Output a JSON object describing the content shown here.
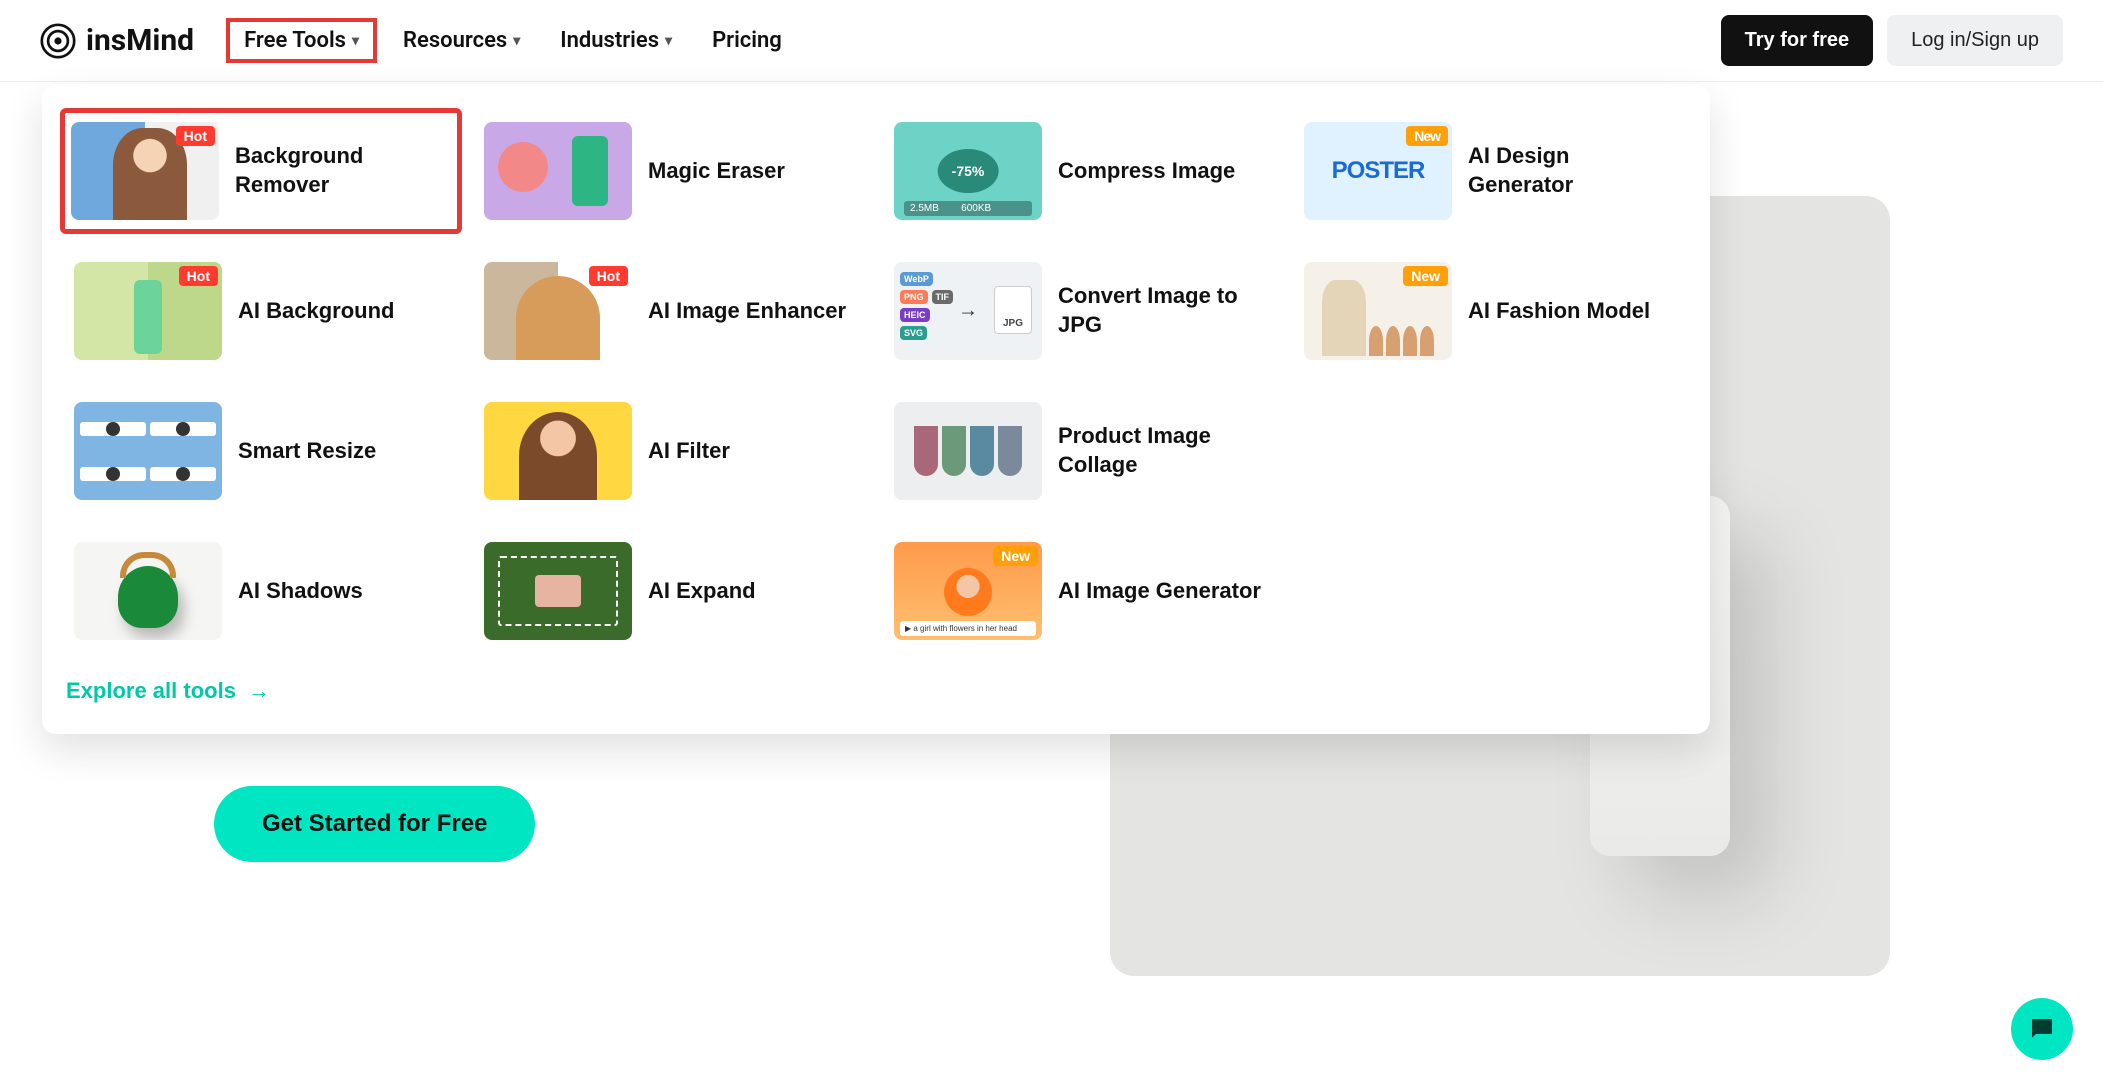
{
  "brand": "insMind",
  "nav": {
    "free_tools": "Free Tools",
    "resources": "Resources",
    "industries": "Industries",
    "pricing": "Pricing"
  },
  "auth": {
    "try": "Try for free",
    "login": "Log in/Sign up"
  },
  "dropdown": {
    "tools": [
      {
        "label": "Background Remover",
        "badge": "Hot",
        "thumb": "bgremove",
        "highlight": true
      },
      {
        "label": "Magic Eraser",
        "badge": null,
        "thumb": "magic"
      },
      {
        "label": "Compress Image",
        "badge": null,
        "thumb": "compress"
      },
      {
        "label": "AI Design Generator",
        "badge": "New",
        "thumb": "design"
      },
      {
        "label": "AI Background",
        "badge": "Hot",
        "thumb": "aibg"
      },
      {
        "label": "AI Image Enhancer",
        "badge": "Hot",
        "thumb": "enhance"
      },
      {
        "label": "Convert Image to JPG",
        "badge": null,
        "thumb": "convert"
      },
      {
        "label": "AI Fashion Model",
        "badge": "New",
        "thumb": "fashion"
      },
      {
        "label": "Smart Resize",
        "badge": null,
        "thumb": "resize"
      },
      {
        "label": "AI Filter",
        "badge": null,
        "thumb": "filter"
      },
      {
        "label": "Product Image Collage",
        "badge": null,
        "thumb": "collage"
      },
      {
        "label": "",
        "badge": null,
        "thumb": null
      },
      {
        "label": "AI Shadows",
        "badge": null,
        "thumb": "shadow"
      },
      {
        "label": "AI Expand",
        "badge": null,
        "thumb": "expand"
      },
      {
        "label": "AI Image Generator",
        "badge": "New",
        "thumb": "aiimg"
      }
    ],
    "explore": "Explore all tools"
  },
  "hero": {
    "cta": "Get Started for Free"
  },
  "thumbs": {
    "design_text": "POSTER",
    "convert_formats": [
      "WebP",
      "PNG",
      "TIF",
      "HEIC",
      "SVG"
    ],
    "convert_target": "JPG"
  }
}
